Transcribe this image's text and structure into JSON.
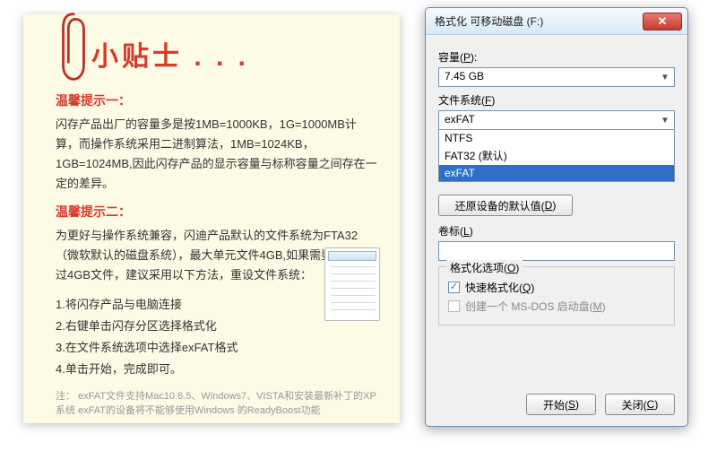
{
  "note": {
    "title": "小贴士 . . .",
    "tip1_head": "温馨提示一：",
    "tip1_body": "闪存产品出厂的容量多是按1MB=1000KB，1G=1000MB计算，而操作系统采用二进制算法，1MB=1024KB，1GB=1024MB,因此闪存产品的显示容量与标称容量之间存在一定的差异。",
    "tip2_head": "温馨提示二：",
    "tip2_body": "为更好与操作系统兼容，闪迪产品默认的文件系统为FTA32（微软默认的磁盘系统），最大单元文件4GB,如果需要存储超过4GB文件，建议采用以下方法，重设文件系统：",
    "steps": [
      "1.将闪存产品与电脑连接",
      "2.右键单击闪存分区选择格式化",
      "3.在文件系统选项中选择exFAT格式",
      "4.单击开始，完成即可。"
    ],
    "foot_label": "注：",
    "foot": "exFAT文件支持Mac10.6.5、Windows7、VISTA和安装最新补丁的XP系统 exFAT的设备将不能够使用Windows 的ReadyBoost功能"
  },
  "dialog": {
    "title": "格式化 可移动磁盘 (F:)",
    "capacity_label_nl": "容量(",
    "capacity_label_ul": "P",
    "capacity_label_end": "):",
    "capacity_value": "7.45 GB",
    "fs_label_nl": "文件系统(",
    "fs_label_ul": "F",
    "fs_label_end": ")",
    "fs_value": "exFAT",
    "fs_options": [
      "NTFS",
      "FAT32 (默认)",
      "exFAT"
    ],
    "restore_btn_nl": "还原设备的默认值(",
    "restore_btn_ul": "D",
    "restore_btn_end": ")",
    "volume_label_nl": "卷标(",
    "volume_label_ul": "L",
    "volume_label_end": ")",
    "volume_value": "",
    "options_group_nl": "格式化选项(",
    "options_group_ul": "O",
    "options_group_end": ")",
    "quick_nl": "快速格式化(",
    "quick_ul": "Q",
    "quick_end": ")",
    "quick_checked": true,
    "msdos_nl": "创建一个 MS-DOS 启动盘(",
    "msdos_ul": "M",
    "msdos_end": ")",
    "msdos_checked": false,
    "start_btn_nl": "开始(",
    "start_btn_ul": "S",
    "start_btn_end": ")",
    "close_btn_nl": "关闭(",
    "close_btn_ul": "C",
    "close_btn_end": ")"
  }
}
